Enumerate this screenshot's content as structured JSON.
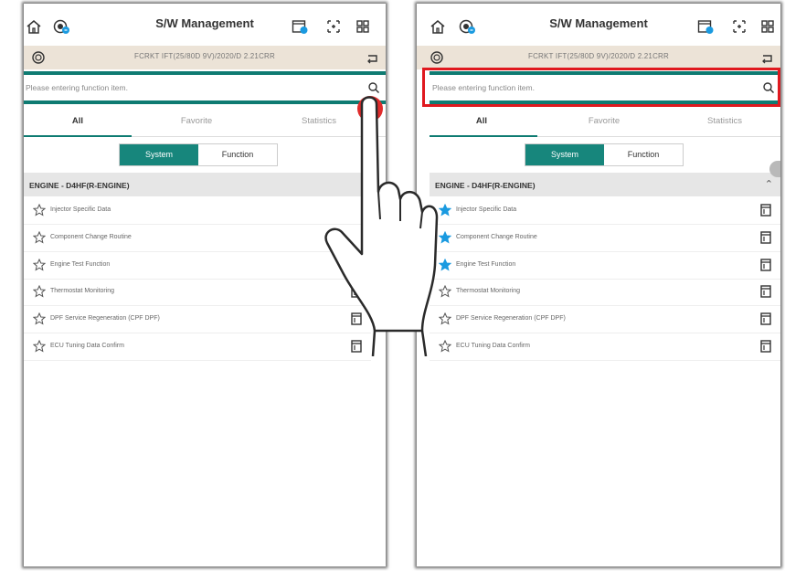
{
  "title": "S/W Management",
  "vin": "FCRKT IFT(25/80D 9V)/2020/D 2.21CRR",
  "search_placeholder": "Please entering function item.",
  "tabs": [
    "All",
    "Favorite",
    "Statistics"
  ],
  "segments": [
    "System",
    "Function"
  ],
  "group_title": "ENGINE - D4HF(R-ENGINE)",
  "items": [
    "Injector Specific Data",
    "Component Change Routine",
    "Engine Test Function",
    "Thermostat Monitoring",
    "DPF Service Regeneration (CPF DPF)",
    "ECU Tuning Data Confirm"
  ],
  "left_favorites": [
    false,
    false,
    false,
    false,
    false,
    false
  ],
  "right_favorites": [
    true,
    true,
    true,
    false,
    false,
    false
  ],
  "colors": {
    "accent": "#0e7b72",
    "highlight": "#e0191f",
    "star_fav": "#1a9ae0",
    "vin_bg": "#ece3d7"
  }
}
